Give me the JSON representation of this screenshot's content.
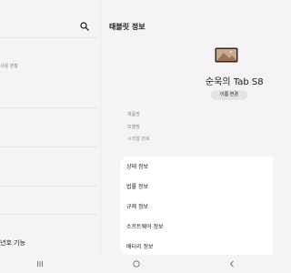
{
  "left_pane": {
    "subtitle_partial": "사용 현황",
    "bottom_partial": "년호 기능"
  },
  "header": {
    "title": "태블릿 정보"
  },
  "device": {
    "name": "순욱의 Tab S8",
    "rename_label": "이름 변경"
  },
  "info_labels": [
    "제품명",
    "모델명",
    "시리얼 번호"
  ],
  "menu": {
    "items": [
      "상태 정보",
      "법률 정보",
      "규제 정보",
      "소프트웨어 정보",
      "배터리 정보"
    ]
  },
  "nav": {
    "icons": [
      "recent-apps-icon",
      "home-icon",
      "back-icon"
    ]
  }
}
